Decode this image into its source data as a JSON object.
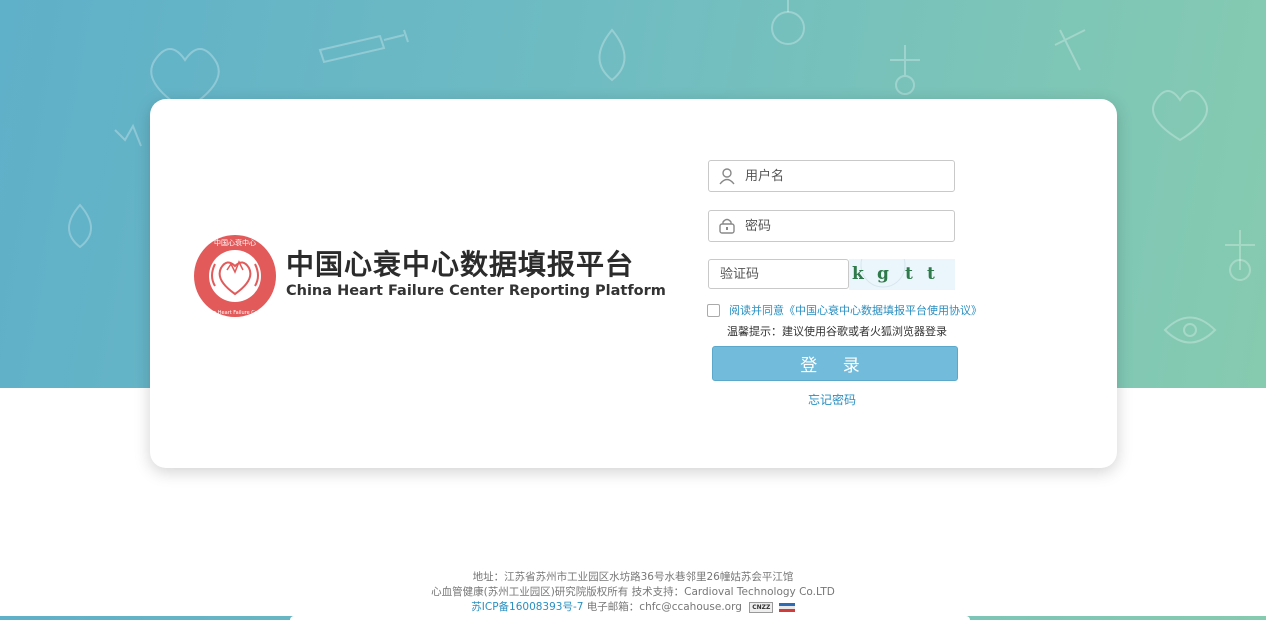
{
  "brand": {
    "title_cn": "中国心衰中心数据填报平台",
    "title_en": "China Heart Failure Center Reporting Platform",
    "badge_top_text": "中国心衰中心",
    "badge_bottom_text": "China Heart Failure Center"
  },
  "login": {
    "username_placeholder": "用户名",
    "password_placeholder": "密码",
    "captcha_placeholder": "验证码",
    "captcha_chars": [
      "k",
      "g",
      "t",
      "t"
    ],
    "agree_text": "阅读并同意《中国心衰中心数据填报平台使用协议》",
    "tip": "温馨提示：建议使用谷歌或者火狐浏览器登录",
    "submit_label": "登 录",
    "forgot_label": "忘记密码"
  },
  "footer": {
    "address": "地址：江苏省苏州市工业园区水坊路36号水巷邻里26幢姑苏会平江馆",
    "copyright": "心血管健康(苏州工业园区)研究院版权所有  技术支持：Cardioval Technology Co.LTD",
    "icp": "苏ICP备16008393号-7",
    "email": "电子邮箱：chfc@ccahouse.org",
    "badge": "CNZZ"
  },
  "colors": {
    "accent": "#72bbdb",
    "link": "#2a8fc1",
    "logo_red": "#e25a5a",
    "hero_left": "#5fb0c9",
    "hero_right": "#86cbb0"
  }
}
